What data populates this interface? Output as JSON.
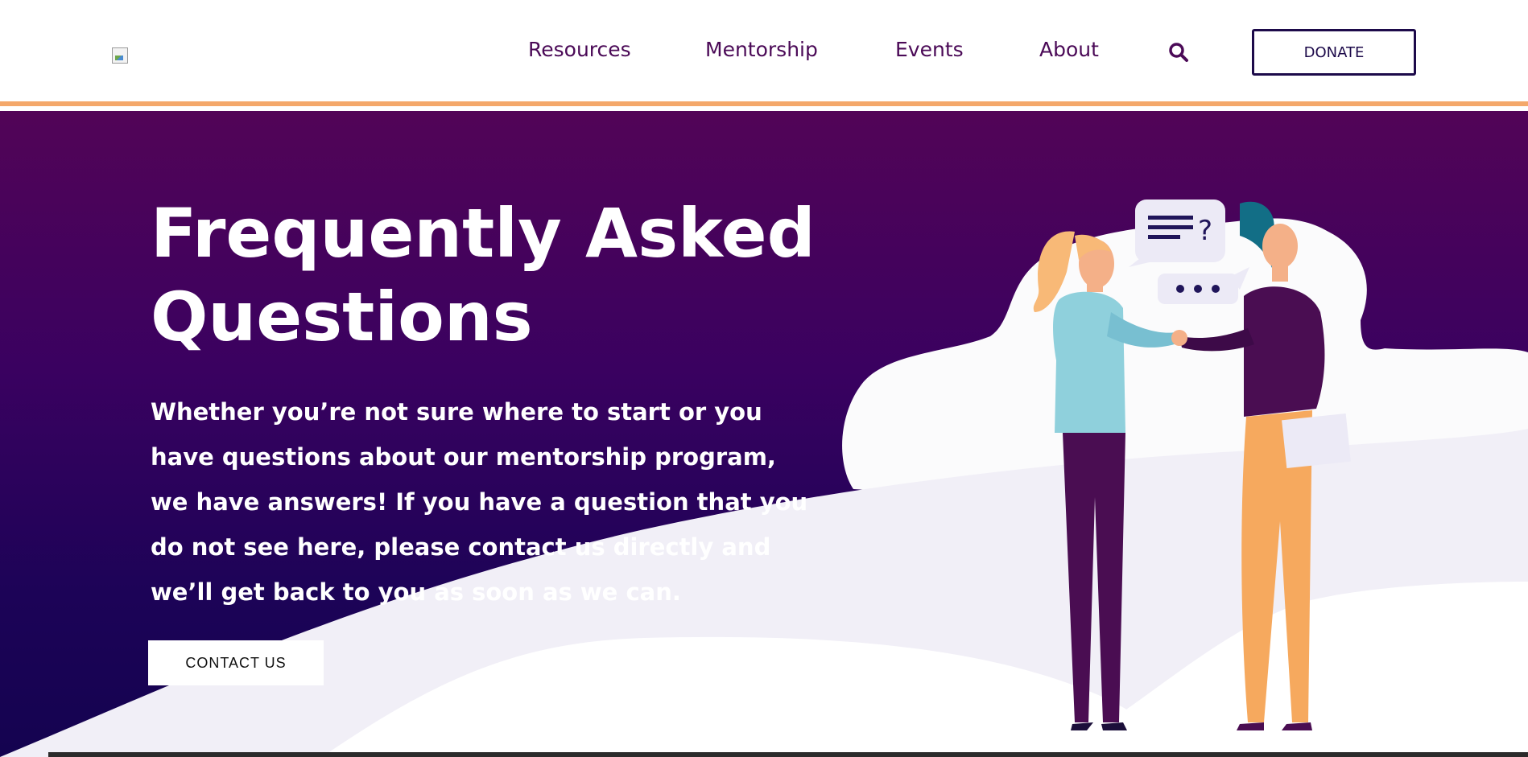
{
  "header": {
    "logo_alt": "",
    "nav": {
      "resources": "Resources",
      "mentorship": "Mentorship",
      "events": "Events",
      "about": "About"
    },
    "search_icon": "search-icon",
    "donate_label": "DONATE"
  },
  "hero": {
    "title": "Frequently Asked Questions",
    "description": "Whether you’re not sure where to start or you have questions about our mentorship program, we have answers! If you have a question that you do not see here, please contact us directly and we’ll get back to you as soon as we can.",
    "contact_label": "CONTACT US"
  },
  "colors": {
    "nav_text": "#4b0a57",
    "accent_bar": "#f4a86a",
    "hero_top": "#520457",
    "hero_bottom": "#140350",
    "donate_border": "#1d0a4a"
  }
}
